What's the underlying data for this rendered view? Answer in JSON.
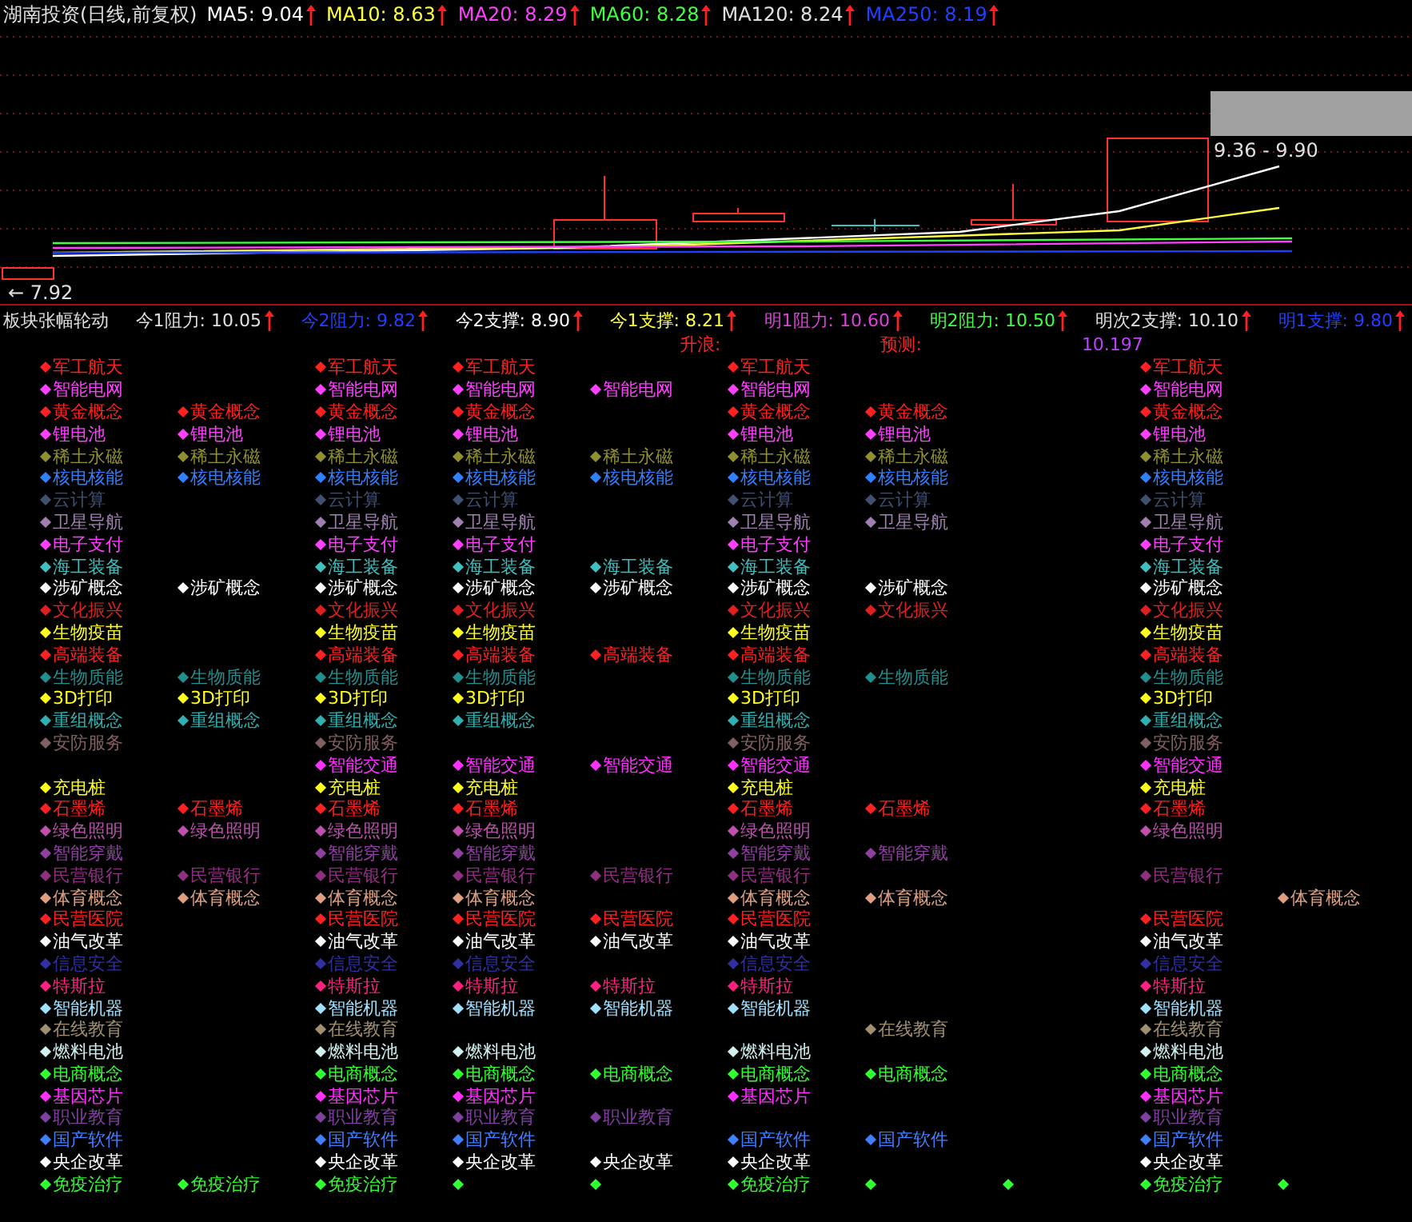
{
  "title_bar": {
    "title": "湖南投资(日线,前复权)",
    "indicators": [
      {
        "text": "MA5: 9.04",
        "color": "#ffffff",
        "rising": true
      },
      {
        "text": "MA10: 8.63",
        "color": "#ffff40",
        "rising": true
      },
      {
        "text": "MA20: 8.29",
        "color": "#ff40ff",
        "rising": true
      },
      {
        "text": "MA60: 8.28",
        "color": "#40ff40",
        "rising": true
      },
      {
        "text": "MA120: 8.24",
        "color": "#e0e0e0",
        "rising": true
      },
      {
        "text": "MA250: 8.19",
        "color": "#2040ff",
        "rising": true
      }
    ]
  },
  "chart": {
    "labels": [
      {
        "kind": "range",
        "text": "9.36 - 9.90"
      },
      {
        "kind": "low",
        "text": "← 7.92"
      }
    ]
  },
  "panel": {
    "title": "板块张幅轮动",
    "levels": [
      {
        "text": "今1阻力: 10.05",
        "color": "#e0e0e0",
        "rising": true
      },
      {
        "text": "今2阻力: 9.82",
        "color": "#2040ff",
        "rising": true
      },
      {
        "text": "今2支撑: 8.90",
        "color": "#ffffff",
        "rising": true
      },
      {
        "text": "今1支撑: 8.21",
        "color": "#ffff40",
        "rising": true
      },
      {
        "text": "明1阻力: 10.60",
        "color": "#e040e0",
        "rising": true
      },
      {
        "text": "明2阻力: 10.50",
        "color": "#40ff40",
        "rising": true
      },
      {
        "text": "明次2支撑: 10.10",
        "color": "#e0e0e0",
        "rising": true
      },
      {
        "text": "明1支撑: 9.80",
        "color": "#2040ff",
        "rising": true
      }
    ],
    "notes": [
      {
        "text": "升浪:",
        "color": "#ff2020"
      },
      {
        "text": "预测:",
        "color": "#ff2020"
      },
      {
        "text": "10.197",
        "color": "#c040ff"
      }
    ]
  },
  "rows": [
    {
      "color": "#ff2020",
      "cells": [
        "军工航天",
        null,
        "军工航天",
        "军工航天",
        null,
        "军工航天",
        null,
        null,
        "军工航天",
        null
      ]
    },
    {
      "color": "#ff40ff",
      "cells": [
        "智能电网",
        null,
        "智能电网",
        "智能电网",
        "智能电网",
        "智能电网",
        null,
        null,
        "智能电网",
        null
      ]
    },
    {
      "color": "#ff2020",
      "cells": [
        "黄金概念",
        "黄金概念",
        "黄金概念",
        "黄金概念",
        null,
        "黄金概念",
        "黄金概念",
        null,
        "黄金概念",
        null
      ]
    },
    {
      "color": "#ff40ff",
      "cells": [
        "锂电池",
        "锂电池",
        "锂电池",
        "锂电池",
        null,
        "锂电池",
        "锂电池",
        null,
        "锂电池",
        null
      ]
    },
    {
      "color": "#909030",
      "cells": [
        "稀土永磁",
        "稀土永磁",
        "稀土永磁",
        "稀土永磁",
        "稀土永磁",
        "稀土永磁",
        "稀土永磁",
        null,
        "稀土永磁",
        null
      ]
    },
    {
      "color": "#3080ff",
      "cells": [
        "核电核能",
        "核电核能",
        "核电核能",
        "核电核能",
        "核电核能",
        "核电核能",
        "核电核能",
        null,
        "核电核能",
        null
      ]
    },
    {
      "color": "#405070",
      "cells": [
        "云计算",
        null,
        "云计算",
        "云计算",
        null,
        "云计算",
        "云计算",
        null,
        "云计算",
        null
      ]
    },
    {
      "color": "#a080b0",
      "cells": [
        "卫星导航",
        null,
        "卫星导航",
        "卫星导航",
        null,
        "卫星导航",
        "卫星导航",
        null,
        "卫星导航",
        null
      ]
    },
    {
      "color": "#ff40ff",
      "cells": [
        "电子支付",
        null,
        "电子支付",
        "电子支付",
        null,
        "电子支付",
        null,
        null,
        "电子支付",
        null
      ]
    },
    {
      "color": "#40c0c0",
      "cells": [
        "海工装备",
        null,
        "海工装备",
        "海工装备",
        "海工装备",
        "海工装备",
        null,
        null,
        "海工装备",
        null
      ]
    },
    {
      "color": "#ffffff",
      "cells": [
        "涉矿概念",
        "涉矿概念",
        "涉矿概念",
        "涉矿概念",
        "涉矿概念",
        "涉矿概念",
        "涉矿概念",
        null,
        "涉矿概念",
        null
      ]
    },
    {
      "color": "#e02020",
      "cells": [
        "文化振兴",
        null,
        "文化振兴",
        "文化振兴",
        null,
        "文化振兴",
        "文化振兴",
        null,
        "文化振兴",
        null
      ]
    },
    {
      "color": "#ffff20",
      "cells": [
        "生物疫苗",
        null,
        "生物疫苗",
        "生物疫苗",
        null,
        "生物疫苗",
        null,
        null,
        "生物疫苗",
        null
      ]
    },
    {
      "color": "#ff2020",
      "cells": [
        "高端装备",
        null,
        "高端装备",
        "高端装备",
        "高端装备",
        "高端装备",
        null,
        null,
        "高端装备",
        null
      ]
    },
    {
      "color": "#209090",
      "cells": [
        "生物质能",
        "生物质能",
        "生物质能",
        "生物质能",
        null,
        "生物质能",
        "生物质能",
        null,
        "生物质能",
        null
      ]
    },
    {
      "color": "#ffff20",
      "cells": [
        "3D打印",
        "3D打印",
        "3D打印",
        "3D打印",
        null,
        "3D打印",
        null,
        null,
        "3D打印",
        null
      ]
    },
    {
      "color": "#30b0b0",
      "cells": [
        "重组概念",
        "重组概念",
        "重组概念",
        "重组概念",
        null,
        "重组概念",
        null,
        null,
        "重组概念",
        null
      ]
    },
    {
      "color": "#806060",
      "cells": [
        "安防服务",
        null,
        "安防服务",
        null,
        null,
        "安防服务",
        null,
        null,
        "安防服务",
        null
      ]
    },
    {
      "color": "#ff30ff",
      "cells": [
        null,
        null,
        "智能交通",
        "智能交通",
        "智能交通",
        "智能交通",
        null,
        null,
        "智能交通",
        null
      ]
    },
    {
      "color": "#ffff20",
      "cells": [
        "充电桩",
        null,
        "充电桩",
        "充电桩",
        null,
        "充电桩",
        null,
        null,
        "充电桩",
        null
      ]
    },
    {
      "color": "#ff2020",
      "cells": [
        "石墨烯",
        "石墨烯",
        "石墨烯",
        "石墨烯",
        null,
        "石墨烯",
        "石墨烯",
        null,
        "石墨烯",
        null
      ]
    },
    {
      "color": "#c050b0",
      "cells": [
        "绿色照明",
        "绿色照明",
        "绿色照明",
        "绿色照明",
        null,
        "绿色照明",
        null,
        null,
        "绿色照明",
        null
      ]
    },
    {
      "color": "#9040a0",
      "cells": [
        "智能穿戴",
        null,
        "智能穿戴",
        "智能穿戴",
        null,
        "智能穿戴",
        "智能穿戴",
        null,
        null,
        null
      ]
    },
    {
      "color": "#903080",
      "cells": [
        "民营银行",
        "民营银行",
        "民营银行",
        "民营银行",
        "民营银行",
        "民营银行",
        null,
        null,
        "民营银行",
        null
      ]
    },
    {
      "color": "#e0a080",
      "cells": [
        "体育概念",
        "体育概念",
        "体育概念",
        "体育概念",
        null,
        "体育概念",
        "体育概念",
        null,
        null,
        "体育概念"
      ]
    },
    {
      "color": "#ff2020",
      "cells": [
        "民营医院",
        null,
        "民营医院",
        "民营医院",
        "民营医院",
        "民营医院",
        null,
        null,
        "民营医院",
        null
      ]
    },
    {
      "color": "#ffffff",
      "cells": [
        "油气改革",
        null,
        "油气改革",
        "油气改革",
        "油气改革",
        "油气改革",
        null,
        null,
        "油气改革",
        null
      ]
    },
    {
      "color": "#3030a0",
      "cells": [
        "信息安全",
        null,
        "信息安全",
        "信息安全",
        null,
        "信息安全",
        null,
        null,
        "信息安全",
        null
      ]
    },
    {
      "color": "#ff2080",
      "cells": [
        "特斯拉",
        null,
        "特斯拉",
        "特斯拉",
        "特斯拉",
        "特斯拉",
        null,
        null,
        "特斯拉",
        null
      ]
    },
    {
      "color": "#a0e0ff",
      "cells": [
        "智能机器",
        null,
        "智能机器",
        "智能机器",
        "智能机器",
        "智能机器",
        null,
        null,
        "智能机器",
        null
      ]
    },
    {
      "color": "#a09070",
      "cells": [
        "在线教育",
        null,
        "在线教育",
        null,
        null,
        null,
        "在线教育",
        null,
        "在线教育",
        null
      ]
    },
    {
      "color": "#d0f0f0",
      "cells": [
        "燃料电池",
        null,
        "燃料电池",
        "燃料电池",
        null,
        "燃料电池",
        null,
        null,
        "燃料电池",
        null
      ]
    },
    {
      "color": "#30ff30",
      "cells": [
        "电商概念",
        null,
        "电商概念",
        "电商概念",
        "电商概念",
        "电商概念",
        "电商概念",
        null,
        "电商概念",
        null
      ]
    },
    {
      "color": "#ff30ff",
      "cells": [
        "基因芯片",
        null,
        "基因芯片",
        "基因芯片",
        null,
        "基因芯片",
        null,
        null,
        "基因芯片",
        null
      ]
    },
    {
      "color": "#8040a0",
      "cells": [
        "职业教育",
        null,
        "职业教育",
        "职业教育",
        "职业教育",
        null,
        null,
        null,
        "职业教育",
        null
      ]
    },
    {
      "color": "#4080ff",
      "cells": [
        "国产软件",
        null,
        "国产软件",
        "国产软件",
        null,
        "国产软件",
        "国产软件",
        null,
        "国产软件",
        null
      ]
    },
    {
      "color": "#ffffff",
      "cells": [
        "央企改革",
        null,
        "央企改革",
        "央企改革",
        "央企改革",
        "央企改革",
        null,
        null,
        "央企改革",
        null
      ]
    },
    {
      "color": "#30ff30",
      "cells": [
        "免疫治疗",
        "免疫治疗",
        "免疫治疗",
        {
          "kind": "dot"
        },
        {
          "kind": "dot"
        },
        "免疫治疗",
        {
          "kind": "dot"
        },
        {
          "kind": "dot"
        },
        "免疫治疗",
        {
          "kind": "dot"
        }
      ]
    }
  ]
}
